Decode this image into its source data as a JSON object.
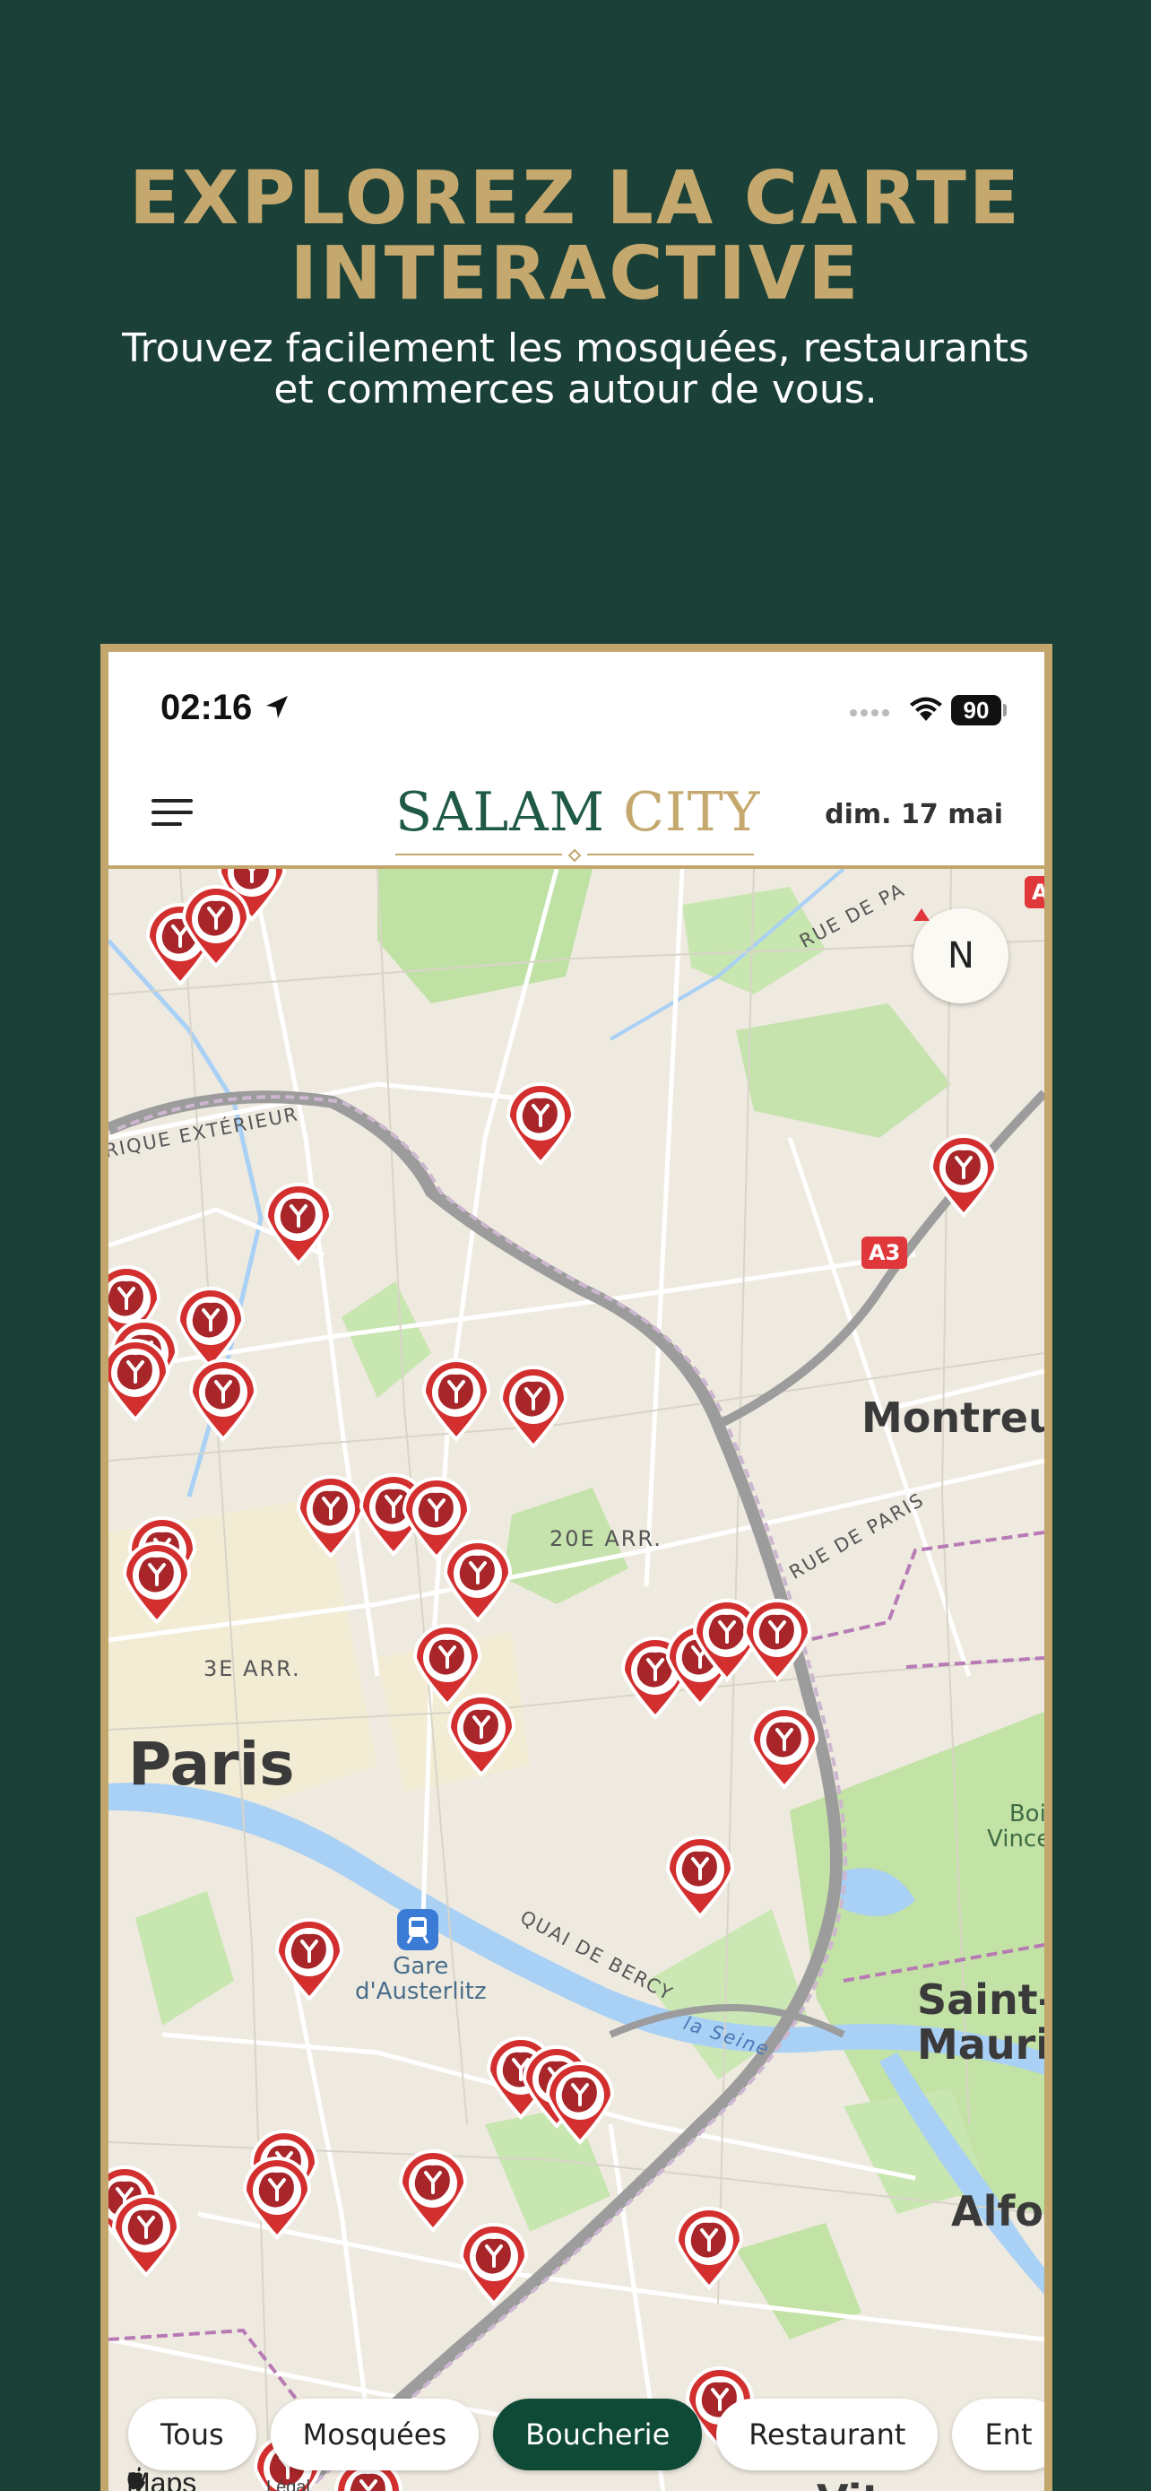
{
  "promo": {
    "headline_line1": "EXPLOREZ LA CARTE",
    "headline_line2": "INTERACTIVE",
    "subtitle_line1": "Trouvez facilement les mosquées, restaurants",
    "subtitle_line2": "et commerces autour de vous."
  },
  "status_bar": {
    "time": "02:16",
    "battery": "90"
  },
  "header": {
    "logo_word1": "SALAM",
    "logo_word2": "CITY",
    "date": "dim. 17 mai"
  },
  "map": {
    "compass": "N",
    "labels": {
      "montreuil": "Montreuil",
      "paris": "Paris",
      "arr20": "20E ARR.",
      "arr3": "3E ARR.",
      "rue_paris_top": "RUE DE PA",
      "rue_paris": "RUE DE PARIS",
      "peripherique": "RIQUE EXTÉRIEUR",
      "quai": "QUAI DE BERCY",
      "seine": "la Seine",
      "gare_line1": "Gare",
      "gare_line2": "d'Austerlitz",
      "bois_line1": "Bois",
      "bois_line2": "Vincenn",
      "saint_line1": "Saint-",
      "saint_line2": "Mauric",
      "alfor": "Alfor",
      "vitry": "Vitry",
      "a3": "A3",
      "a_top": "A"
    },
    "attribution": "Maps",
    "legal": "Légal"
  },
  "filters": [
    {
      "label": "Tous",
      "active": false
    },
    {
      "label": "Mosquées",
      "active": false
    },
    {
      "label": "Boucherie",
      "active": true
    },
    {
      "label": "Restaurant",
      "active": false
    },
    {
      "label": "Ent",
      "active": false
    }
  ],
  "colors": {
    "background": "#1a4037",
    "gold": "#c4a86e",
    "brand_green": "#0f4a36",
    "pin_red": "#d32f2f"
  },
  "pin_icon": "steak-icon"
}
